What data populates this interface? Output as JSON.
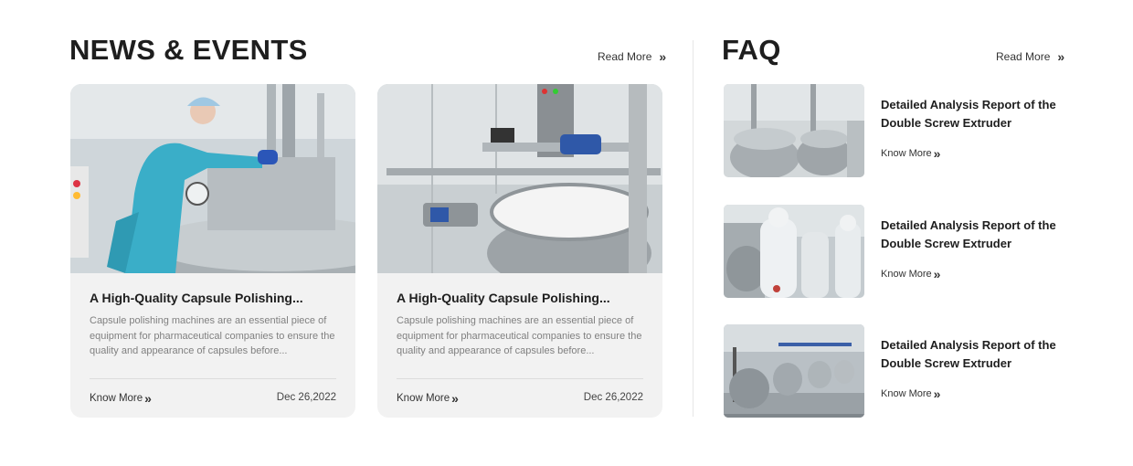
{
  "news": {
    "title": "NEWS & EVENTS",
    "read_more": "Read More",
    "cards": [
      {
        "image": "lab-technician-steel-vessel",
        "title": "A High-Quality Capsule Polishing...",
        "description": "Capsule polishing machines are an essential piece of equipment for pharmaceutical companies to ensure the quality and appearance of capsules before...",
        "know_more": "Know More",
        "date": "Dec 26,2022"
      },
      {
        "image": "mixing-tank-with-white-liquid",
        "title": "A High-Quality Capsule Polishing...",
        "description": "Capsule polishing machines are an essential piece of equipment for pharmaceutical companies to ensure the quality and appearance of capsules before...",
        "know_more": "Know More",
        "date": "Dec 26,2022"
      }
    ]
  },
  "faq": {
    "title": "FAQ",
    "read_more": "Read More",
    "items": [
      {
        "image": "stainless-reactor-tanks",
        "title": "Detailed Analysis Report of the Double Screw Extruder",
        "know_more": "Know More"
      },
      {
        "image": "workers-in-cleanroom-suits",
        "title": "Detailed Analysis Report of the Double Screw Extruder",
        "know_more": "Know More"
      },
      {
        "image": "factory-hall-with-tanks",
        "title": "Detailed Analysis Report of the Double Screw Extruder",
        "know_more": "Know More"
      }
    ]
  },
  "icons": {
    "chevron": "double-chevron-right-icon"
  },
  "colors": {
    "card_bg": "#f2f2f2",
    "heading": "#1e1e1e",
    "muted_text": "#808080"
  }
}
